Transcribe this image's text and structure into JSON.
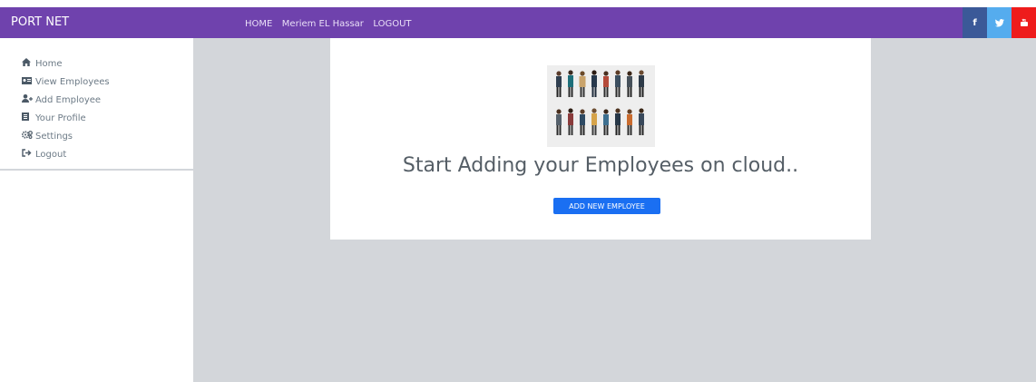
{
  "navbar": {
    "brand": "PORT NET",
    "links": [
      "HOME",
      "Meriem EL Hassar",
      "LOGOUT"
    ],
    "background": "#6f42ad"
  },
  "social": [
    {
      "icon": "facebook-icon",
      "glyph": "f",
      "color": "#3b5998"
    },
    {
      "icon": "twitter-icon",
      "glyph": "🐦",
      "color": "#55acee"
    },
    {
      "icon": "youtube-icon",
      "glyph": "▶",
      "color": "#ee1c1c"
    }
  ],
  "sidebar": {
    "items": [
      {
        "label": "Home",
        "icon": "home-icon"
      },
      {
        "label": "View Employees",
        "icon": "id-card-icon"
      },
      {
        "label": "Add Employee",
        "icon": "user-plus-icon"
      },
      {
        "label": "Your Profile",
        "icon": "profile-icon"
      },
      {
        "label": "Settings",
        "icon": "gears-icon"
      },
      {
        "label": "Logout",
        "icon": "sign-out-icon"
      }
    ]
  },
  "main": {
    "headline": "Start Adding your Employees on cloud..",
    "button_label": "ADD NEW EMPLOYEE",
    "illustration": "employees-illustration"
  },
  "colors": {
    "button": "#1a6ff2",
    "main_background": "#d3d6da"
  }
}
